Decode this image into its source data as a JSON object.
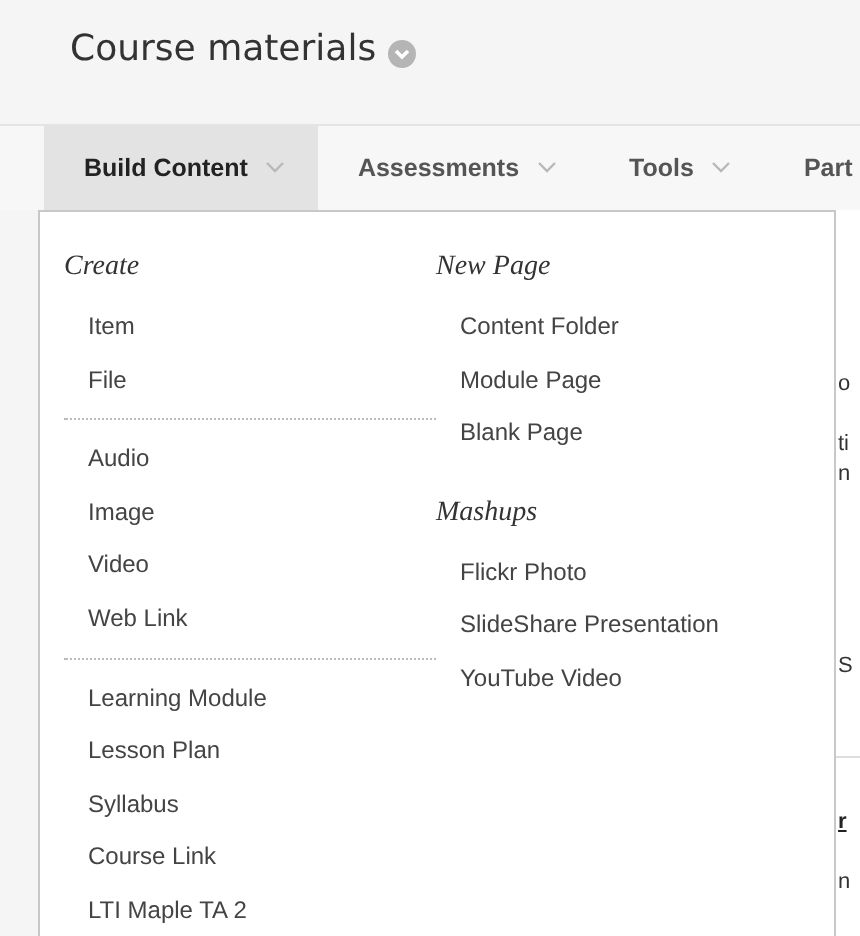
{
  "title": "Course materials",
  "tabs": [
    {
      "label": "Build Content",
      "selected": true,
      "has_caret": true
    },
    {
      "label": "Assessments",
      "selected": false,
      "has_caret": true
    },
    {
      "label": "Tools",
      "selected": false,
      "has_caret": true
    },
    {
      "label": "Part",
      "selected": false,
      "has_caret": false
    }
  ],
  "menu": {
    "columns": [
      {
        "sections": [
          {
            "heading": "Create",
            "divider_above": false,
            "items": [
              "Item",
              "File"
            ]
          },
          {
            "divider_above": true,
            "items": [
              "Audio",
              "Image",
              "Video",
              "Web Link"
            ]
          },
          {
            "divider_above": true,
            "items": [
              "Learning Module",
              "Lesson Plan",
              "Syllabus",
              "Course Link",
              "LTI Maple TA 2"
            ]
          }
        ]
      },
      {
        "sections": [
          {
            "heading": "New Page",
            "divider_above": false,
            "items": [
              "Content Folder",
              "Module Page",
              "Blank Page"
            ]
          },
          {
            "heading": "Mashups",
            "divider_above": false,
            "items": [
              "Flickr Photo",
              "SlideShare Presentation",
              "YouTube Video"
            ]
          }
        ]
      }
    ]
  },
  "background_fragments": [
    {
      "text": "o",
      "kind": "text"
    },
    {
      "text": "ti",
      "kind": "text"
    },
    {
      "text": "n",
      "kind": "text"
    },
    {
      "text": "S",
      "kind": "text"
    },
    {
      "text": "r",
      "kind": "link"
    },
    {
      "text": "n",
      "kind": "text"
    }
  ]
}
